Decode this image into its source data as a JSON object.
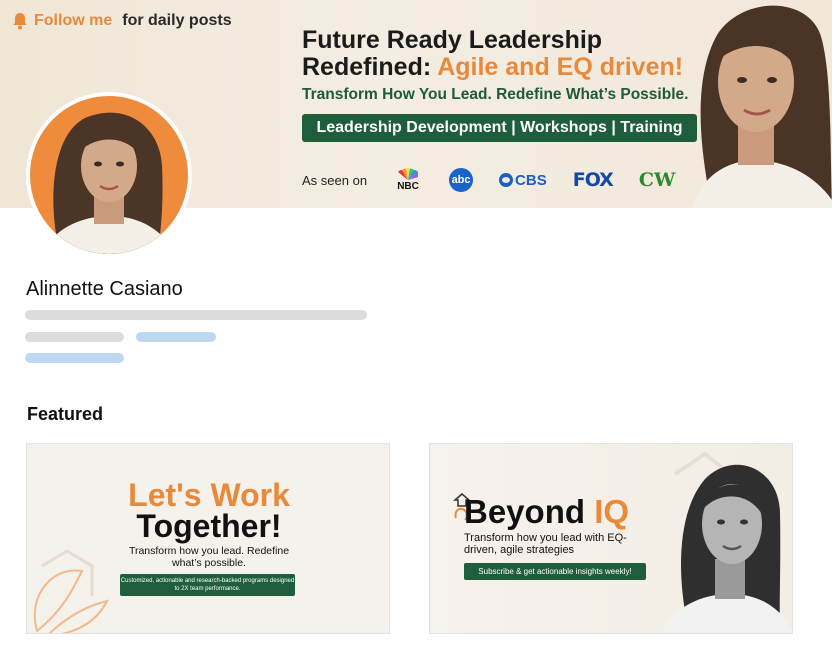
{
  "banner": {
    "follow_em": "Follow me",
    "follow_rest": "for daily posts",
    "title_line1": "Future Ready Leadership",
    "title_line2_dark": "Redefined: ",
    "title_line2_accent": "Agile and EQ driven!",
    "subtitle": "Transform How You Lead. Redefine What’s Possible.",
    "pill": "Leadership Development | Workshops | Training",
    "seen_label": "As seen on",
    "logos": [
      "NBC",
      "abc",
      "CBS",
      "FOX",
      "CW"
    ]
  },
  "profile": {
    "name": "Alinnette Casiano"
  },
  "featured": {
    "heading": "Featured",
    "cards": [
      {
        "title_orange": "Let's Work",
        "title_dark": "Together!",
        "subtitle": "Transform how you lead. Redefine what’s possible.",
        "pill": "Customized, actionable and research-backed programs designed to 2X team performance."
      },
      {
        "title_dark": "Beyond ",
        "title_orange": "IQ",
        "subtitle": "Transform how you lead with EQ-driven, agile strategies",
        "pill": "Subscribe & get actionable insights weekly!"
      }
    ]
  },
  "colors": {
    "accent_orange": "#e98a3b",
    "brand_green": "#1f5e3d",
    "link_blue": "#bfd8f2"
  },
  "icons": [
    "bell-icon",
    "nbc-logo-icon",
    "abc-logo-icon",
    "cbs-logo-icon",
    "fox-logo-icon",
    "cw-logo-icon"
  ]
}
